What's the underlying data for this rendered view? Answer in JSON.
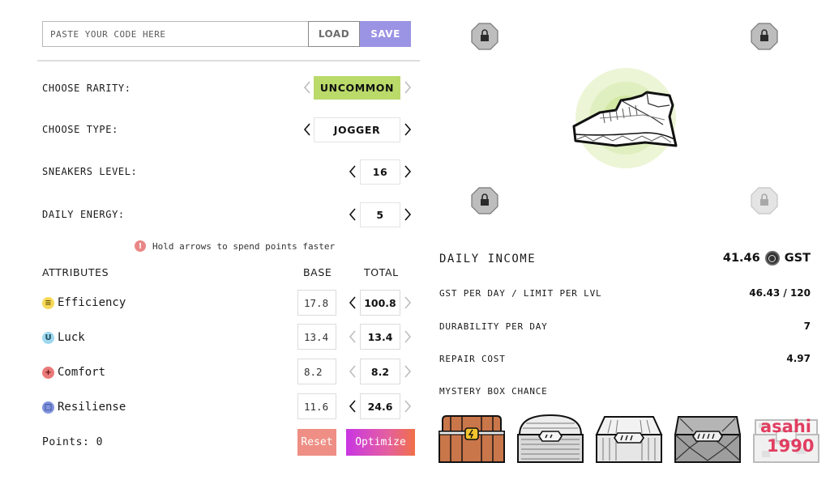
{
  "code": {
    "placeholder": "PASTE YOUR CODE HERE",
    "value": ""
  },
  "toolbar": {
    "load_label": "LOAD",
    "save_label": "SAVE"
  },
  "rarity": {
    "label": "CHOOSE RARITY:",
    "value": "UNCOMMON"
  },
  "type": {
    "label": "CHOOSE TYPE:",
    "value": "JOGGER"
  },
  "level": {
    "label": "SNEAKERS LEVEL:",
    "value": "16"
  },
  "energy": {
    "label": "DAILY ENERGY:",
    "value": "5"
  },
  "hint": {
    "icon": "!",
    "text": "Hold arrows to spend points faster"
  },
  "attributes": {
    "header": "ATTRIBUTES",
    "base_header": "BASE",
    "total_header": "TOTAL",
    "items": [
      {
        "name": "Efficiency",
        "icon": "efficiency-icon",
        "icon_glyph": "≡",
        "color": "#f6d95a",
        "base": "17.8",
        "total": "100.8"
      },
      {
        "name": "Luck",
        "icon": "luck-icon",
        "icon_glyph": "U",
        "color": "#9fd8ee",
        "base": "13.4",
        "total": "13.4"
      },
      {
        "name": "Comfort",
        "icon": "comfort-icon",
        "icon_glyph": "+",
        "color": "#ea7a78",
        "base": "8.2",
        "total": "8.2"
      },
      {
        "name": "Resiliense",
        "icon": "resilience-icon",
        "icon_glyph": "□",
        "color": "#7f93df",
        "base": "11.6",
        "total": "24.6"
      }
    ]
  },
  "points": {
    "text": "Points: 0"
  },
  "actions": {
    "reset_label": "Reset",
    "optimize_label": "Optimize"
  },
  "income": {
    "title": "DAILY INCOME",
    "value": "41.46",
    "currency": "GST",
    "stats": [
      {
        "label": "GST PER DAY / LIMIT PER LVL",
        "value": "46.43 / 120"
      },
      {
        "label": "DURABILITY PER DAY",
        "value": "7"
      },
      {
        "label": "REPAIR COST",
        "value": "4.97"
      },
      {
        "label": "MYSTERY BOX CHANCE",
        "value": ""
      }
    ]
  },
  "watermark": {
    "line1": "asahi",
    "line2": "1990"
  },
  "colors": {
    "accent_save": "#9b93e3",
    "rarity_uncommon": "#bada6a",
    "reset": "#ee8e84",
    "optimize_start": "#c936e3",
    "optimize_end": "#f07048",
    "watermark": "#e02f55"
  }
}
